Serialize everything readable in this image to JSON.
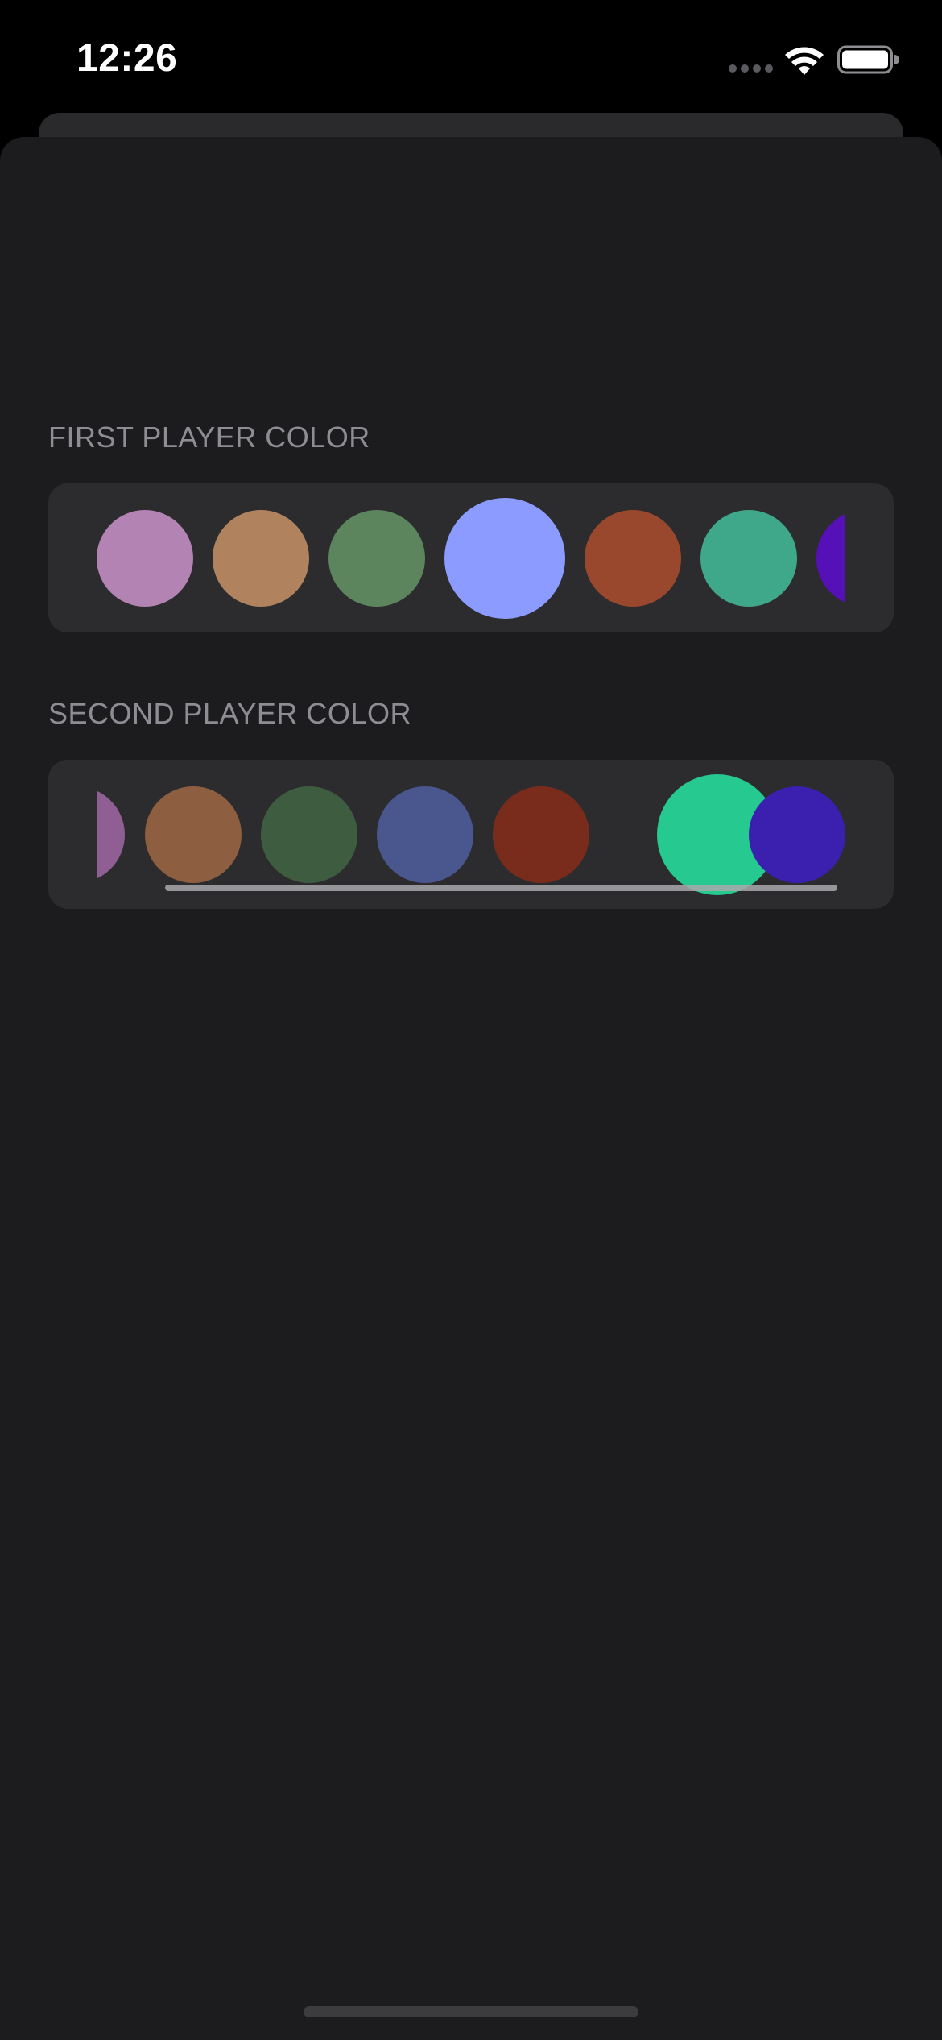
{
  "status_bar": {
    "time": "12:26",
    "signal_icon": "cellular-dots-icon",
    "wifi_icon": "wifi-icon",
    "battery_icon": "battery-icon"
  },
  "sections": [
    {
      "header": "FIRST PLAYER COLOR",
      "selected_index": 3,
      "swatches": [
        {
          "color": "#b283b3"
        },
        {
          "color": "#b0835e"
        },
        {
          "color": "#5c845d"
        },
        {
          "color": "#8c9bff"
        },
        {
          "color": "#9a482d"
        },
        {
          "color": "#40a88a"
        },
        {
          "color": "#5511b7"
        }
      ]
    },
    {
      "header": "SECOND PLAYER COLOR",
      "selected_index": 6,
      "swatches": [
        {
          "color": "#8f5f94"
        },
        {
          "color": "#8e5e40"
        },
        {
          "color": "#3e5d40"
        },
        {
          "color": "#4a578e"
        },
        {
          "color": "#7a2c1c"
        },
        {
          "color": "#26c98f"
        },
        {
          "color": "#3b1fae"
        }
      ]
    }
  ]
}
